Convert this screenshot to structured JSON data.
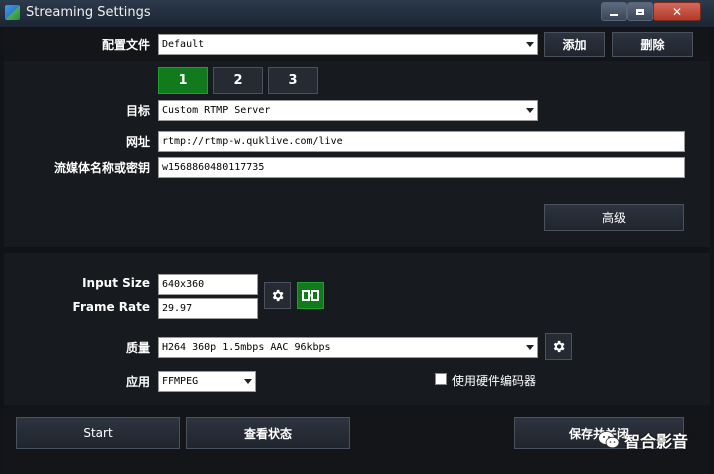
{
  "window": {
    "title": "Streaming Settings"
  },
  "profile": {
    "label": "配置文件",
    "value": "Default",
    "add_label": "添加",
    "delete_label": "删除"
  },
  "tabs": [
    {
      "label": "1"
    },
    {
      "label": "2"
    },
    {
      "label": "3"
    }
  ],
  "target": {
    "label": "目标",
    "value": "Custom RTMP Server"
  },
  "url": {
    "label": "网址",
    "value": "rtmp://rtmp-w.quklive.com/live"
  },
  "stream_key": {
    "label": "流媒体名称或密钥",
    "value": "w1568860480117735"
  },
  "advanced_label": "高级",
  "input_size": {
    "label": "Input Size",
    "value": "640x360"
  },
  "frame_rate": {
    "label": "Frame Rate",
    "value": "29.97"
  },
  "quality": {
    "label": "质量",
    "value": "H264 360p 1.5mbps AAC 96kbps"
  },
  "application": {
    "label": "应用",
    "value": "FFMPEG"
  },
  "hardware_encoder": {
    "label": "使用硬件编码器",
    "checked": false
  },
  "footer": {
    "start_label": "Start",
    "status_label": "查看状态",
    "save_close_label": "保存并关闭"
  },
  "watermark": {
    "text": "智合影音"
  },
  "colors": {
    "accent_green": "#107a1c",
    "background": "#171a1e",
    "title_bar": "#2c3a4d"
  }
}
